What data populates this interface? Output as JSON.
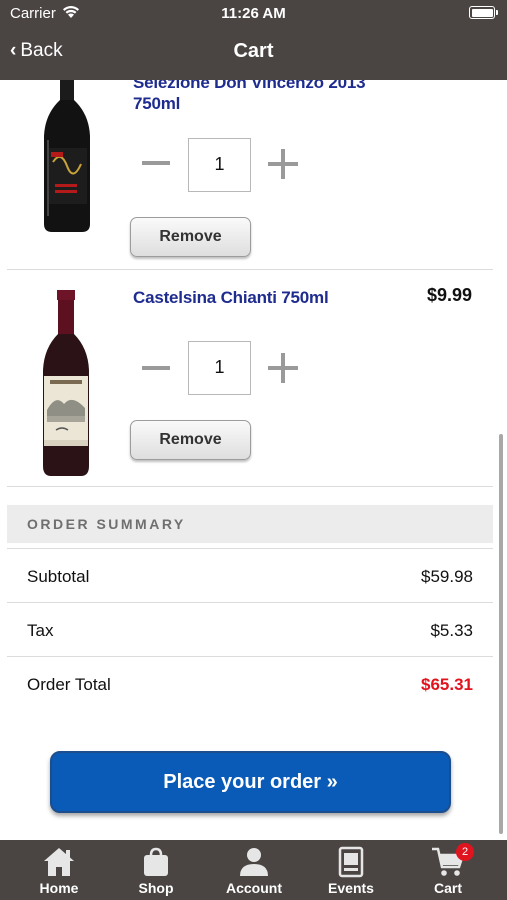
{
  "status_bar": {
    "carrier": "Carrier",
    "time": "11:26 AM"
  },
  "nav": {
    "back_label": "Back",
    "title": "Cart"
  },
  "cart_items": [
    {
      "name_line1": "Selezione Don Vincenzo 2013",
      "name_line2": "750ml",
      "price": "",
      "quantity": "1",
      "remove_label": "Remove",
      "bottle_icon": "red-wine-bottle"
    },
    {
      "name_line1": "Castelsina Chianti 750ml",
      "name_line2": "",
      "price": "$9.99",
      "quantity": "1",
      "remove_label": "Remove",
      "bottle_icon": "chianti-wine-bottle"
    }
  ],
  "summary": {
    "heading": "ORDER SUMMARY",
    "subtotal_label": "Subtotal",
    "subtotal_value": "$59.98",
    "tax_label": "Tax",
    "tax_value": "$5.33",
    "total_label": "Order Total",
    "total_value": "$65.31",
    "total_color": "#e0141e"
  },
  "order_button": {
    "label": "Place your order »",
    "color": "#0a5bb7"
  },
  "tabs": [
    {
      "label": "Home",
      "icon": "home-icon"
    },
    {
      "label": "Shop",
      "icon": "shopping-bag-icon"
    },
    {
      "label": "Account",
      "icon": "person-icon"
    },
    {
      "label": "Events",
      "icon": "calendar-icon"
    },
    {
      "label": "Cart",
      "icon": "cart-icon",
      "badge": "2"
    }
  ],
  "colors": {
    "bar_background": "#4a4543",
    "item_title": "#1f2c8f"
  }
}
